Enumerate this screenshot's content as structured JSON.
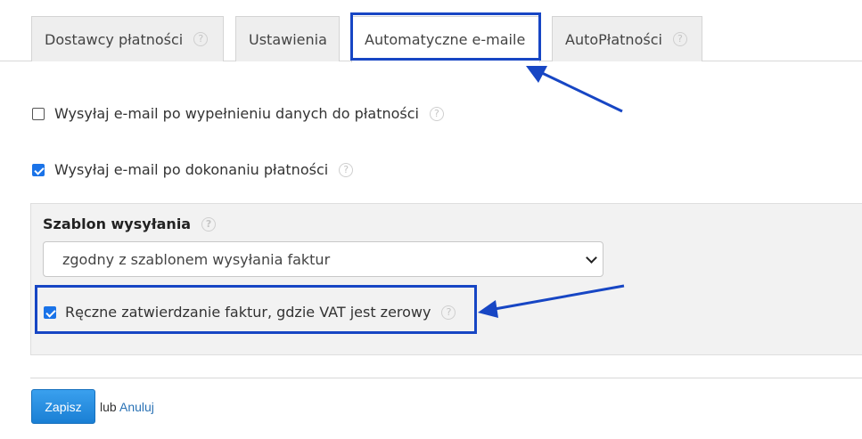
{
  "tabs": [
    {
      "label": "Dostawcy płatności",
      "has_help": true
    },
    {
      "label": "Ustawienia",
      "has_help": false
    },
    {
      "label": "Automatyczne e-maile",
      "has_help": false,
      "active": true
    },
    {
      "label": "AutoPłatności",
      "has_help": true
    }
  ],
  "help_glyph": "?",
  "options": {
    "send_after_data": {
      "label": "Wysyłaj e-mail po wypełnieniu danych do płatności",
      "checked": false
    },
    "send_after_payment": {
      "label": "Wysyłaj e-mail po dokonaniu płatności",
      "checked": true
    }
  },
  "template_panel": {
    "title": "Szablon wysyłania",
    "select_value": "zgodny z szablonem wysyłania faktur",
    "manual_approval": {
      "label": "Ręczne zatwierdzanie faktur, gdzie VAT jest zerowy",
      "checked": true
    }
  },
  "footer": {
    "save_label": "Zapisz",
    "or_text": "lub",
    "cancel_label": "Anuluj"
  },
  "annotation_color": "#1746c4",
  "accent_color": "#1a73e8"
}
